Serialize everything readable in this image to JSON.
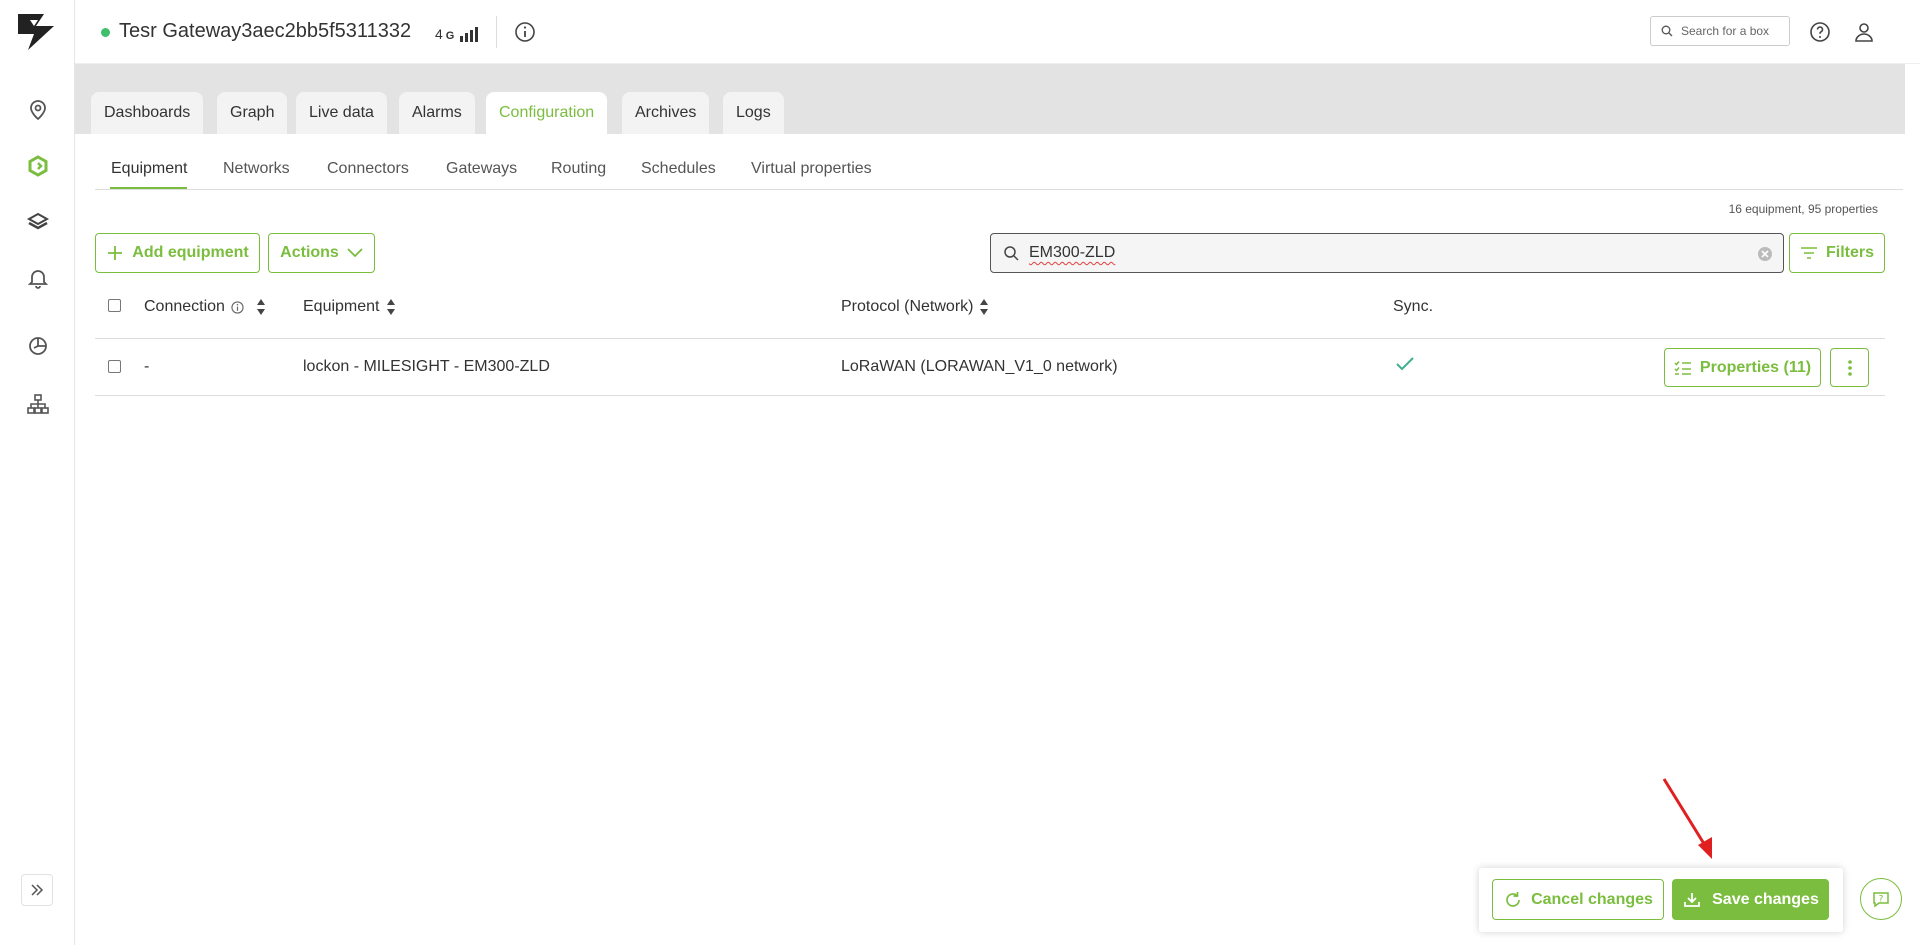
{
  "header": {
    "box_name": "Tesr Gateway3aec2bb5f5311332",
    "network_type": "4",
    "network_sub": "G",
    "search_placeholder": "Search for a box",
    "status_color": "#3fbf6b"
  },
  "sidebar": {
    "items": [
      "location-icon",
      "equipment-config-icon",
      "layers-icon",
      "bell-icon",
      "dashboard-icon",
      "network-tree-icon"
    ],
    "collapse": "expand-icon"
  },
  "main_tabs": [
    {
      "label": "Dashboards"
    },
    {
      "label": "Graph"
    },
    {
      "label": "Live data"
    },
    {
      "label": "Alarms"
    },
    {
      "label": "Configuration",
      "active": true
    },
    {
      "label": "Archives"
    },
    {
      "label": "Logs"
    }
  ],
  "sub_tabs": [
    {
      "label": "Equipment",
      "active": true
    },
    {
      "label": "Networks"
    },
    {
      "label": "Connectors"
    },
    {
      "label": "Gateways"
    },
    {
      "label": "Routing"
    },
    {
      "label": "Schedules"
    },
    {
      "label": "Virtual properties"
    }
  ],
  "summary": "16 equipment, 95 properties",
  "toolbar": {
    "add_label": "Add equipment",
    "actions_label": "Actions",
    "search_value": "EM300-ZLD",
    "filters_label": "Filters"
  },
  "table": {
    "columns": [
      "Connection",
      "Equipment",
      "Protocol (Network)",
      "Sync."
    ],
    "rows": [
      {
        "connection": "-",
        "equipment": "lockon - MILESIGHT - EM300-ZLD",
        "protocol": "LoRaWAN (LORAWAN_V1_0 network)",
        "sync": "check-icon",
        "properties_label": "Properties (11)"
      }
    ]
  },
  "footer": {
    "cancel_label": "Cancel changes",
    "save_label": "Save changes"
  },
  "colors": {
    "accent": "#7bbd3f",
    "annotation_arrow": "#e02020"
  }
}
